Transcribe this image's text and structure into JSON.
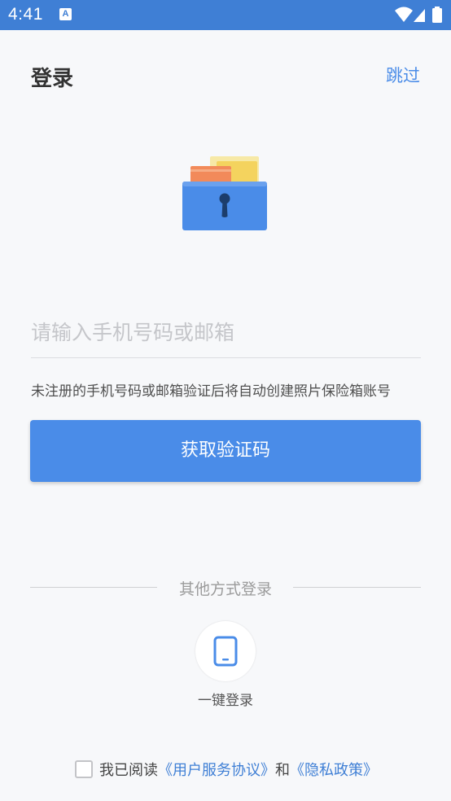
{
  "status_bar": {
    "time": "4:41",
    "notification_icon_text": "A",
    "icons": [
      "wifi-icon",
      "signal-icon",
      "battery-icon"
    ]
  },
  "header": {
    "title": "登录",
    "skip_label": "跳过"
  },
  "hero": {
    "icon": "photo-safe-lock-icon"
  },
  "form": {
    "account_placeholder": "请输入手机号码或邮箱",
    "account_value": "",
    "hint": "未注册的手机号码或邮箱验证后将自动创建照片保险箱账号",
    "submit_label": "获取验证码"
  },
  "other_login": {
    "divider_text": "其他方式登录",
    "one_click_icon": "phone-icon",
    "one_click_label": "一键登录"
  },
  "agreement": {
    "checked": false,
    "prefix": "我已阅读",
    "user_agreement": "《用户服务协议》",
    "and": "和",
    "privacy_policy": "《隐私政策》"
  },
  "colors": {
    "status_bar": "#3f7fd5",
    "accent": "#4a8ce8",
    "background": "#f7f8fa"
  }
}
